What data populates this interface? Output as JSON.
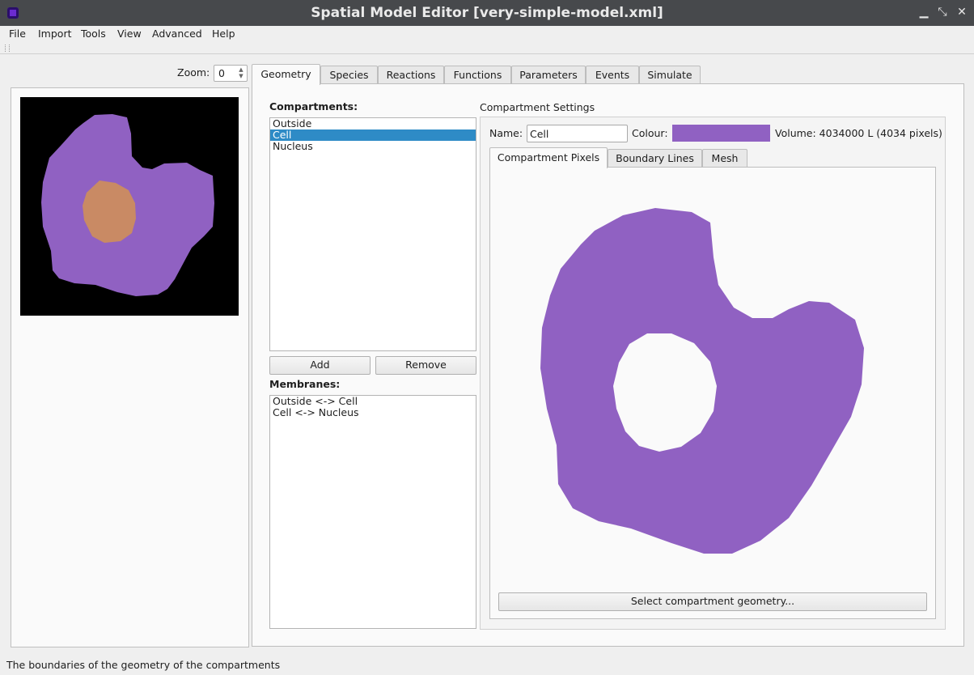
{
  "window": {
    "title": "Spatial Model Editor [very-simple-model.xml]",
    "controls": [
      "minimize",
      "restore",
      "close"
    ]
  },
  "menu": {
    "items": [
      {
        "label": "File",
        "mnemonic": "F"
      },
      {
        "label": "Import",
        "mnemonic": "I"
      },
      {
        "label": "Tools",
        "mnemonic": "T"
      },
      {
        "label": "View",
        "mnemonic": "V"
      },
      {
        "label": "Advanced",
        "mnemonic": "A"
      },
      {
        "label": "Help",
        "mnemonic": "H"
      }
    ]
  },
  "zoom": {
    "label": "Zoom:",
    "value": "0"
  },
  "tabs": [
    "Geometry",
    "Species",
    "Reactions",
    "Functions",
    "Parameters",
    "Events",
    "Simulate"
  ],
  "active_tab": "Geometry",
  "geometry": {
    "compartments_label": "Compartments:",
    "compartments": [
      "Outside",
      "Cell",
      "Nucleus"
    ],
    "selected_compartment": "Cell",
    "add_label": "Add",
    "remove_label": "Remove",
    "membranes_label": "Membranes:",
    "membranes": [
      "Outside <-> Cell",
      "Cell <-> Nucleus"
    ],
    "settings": {
      "title": "Compartment Settings",
      "name_label": "Name:",
      "name_value": "Cell",
      "colour_label": "Colour:",
      "colour": "#9061c2",
      "volume_text": "Volume: 4034000 L (4034 pixels)",
      "subtabs": [
        "Compartment Pixels",
        "Boundary Lines",
        "Mesh"
      ],
      "active_subtab": "Compartment Pixels",
      "select_geometry_label": "Select compartment geometry..."
    }
  },
  "colors": {
    "cell": "#9061c2",
    "nucleus": "#c98a64",
    "outside": "#000000",
    "selection": "#2e8bc6"
  },
  "status": "The boundaries of the geometry of the compartments"
}
